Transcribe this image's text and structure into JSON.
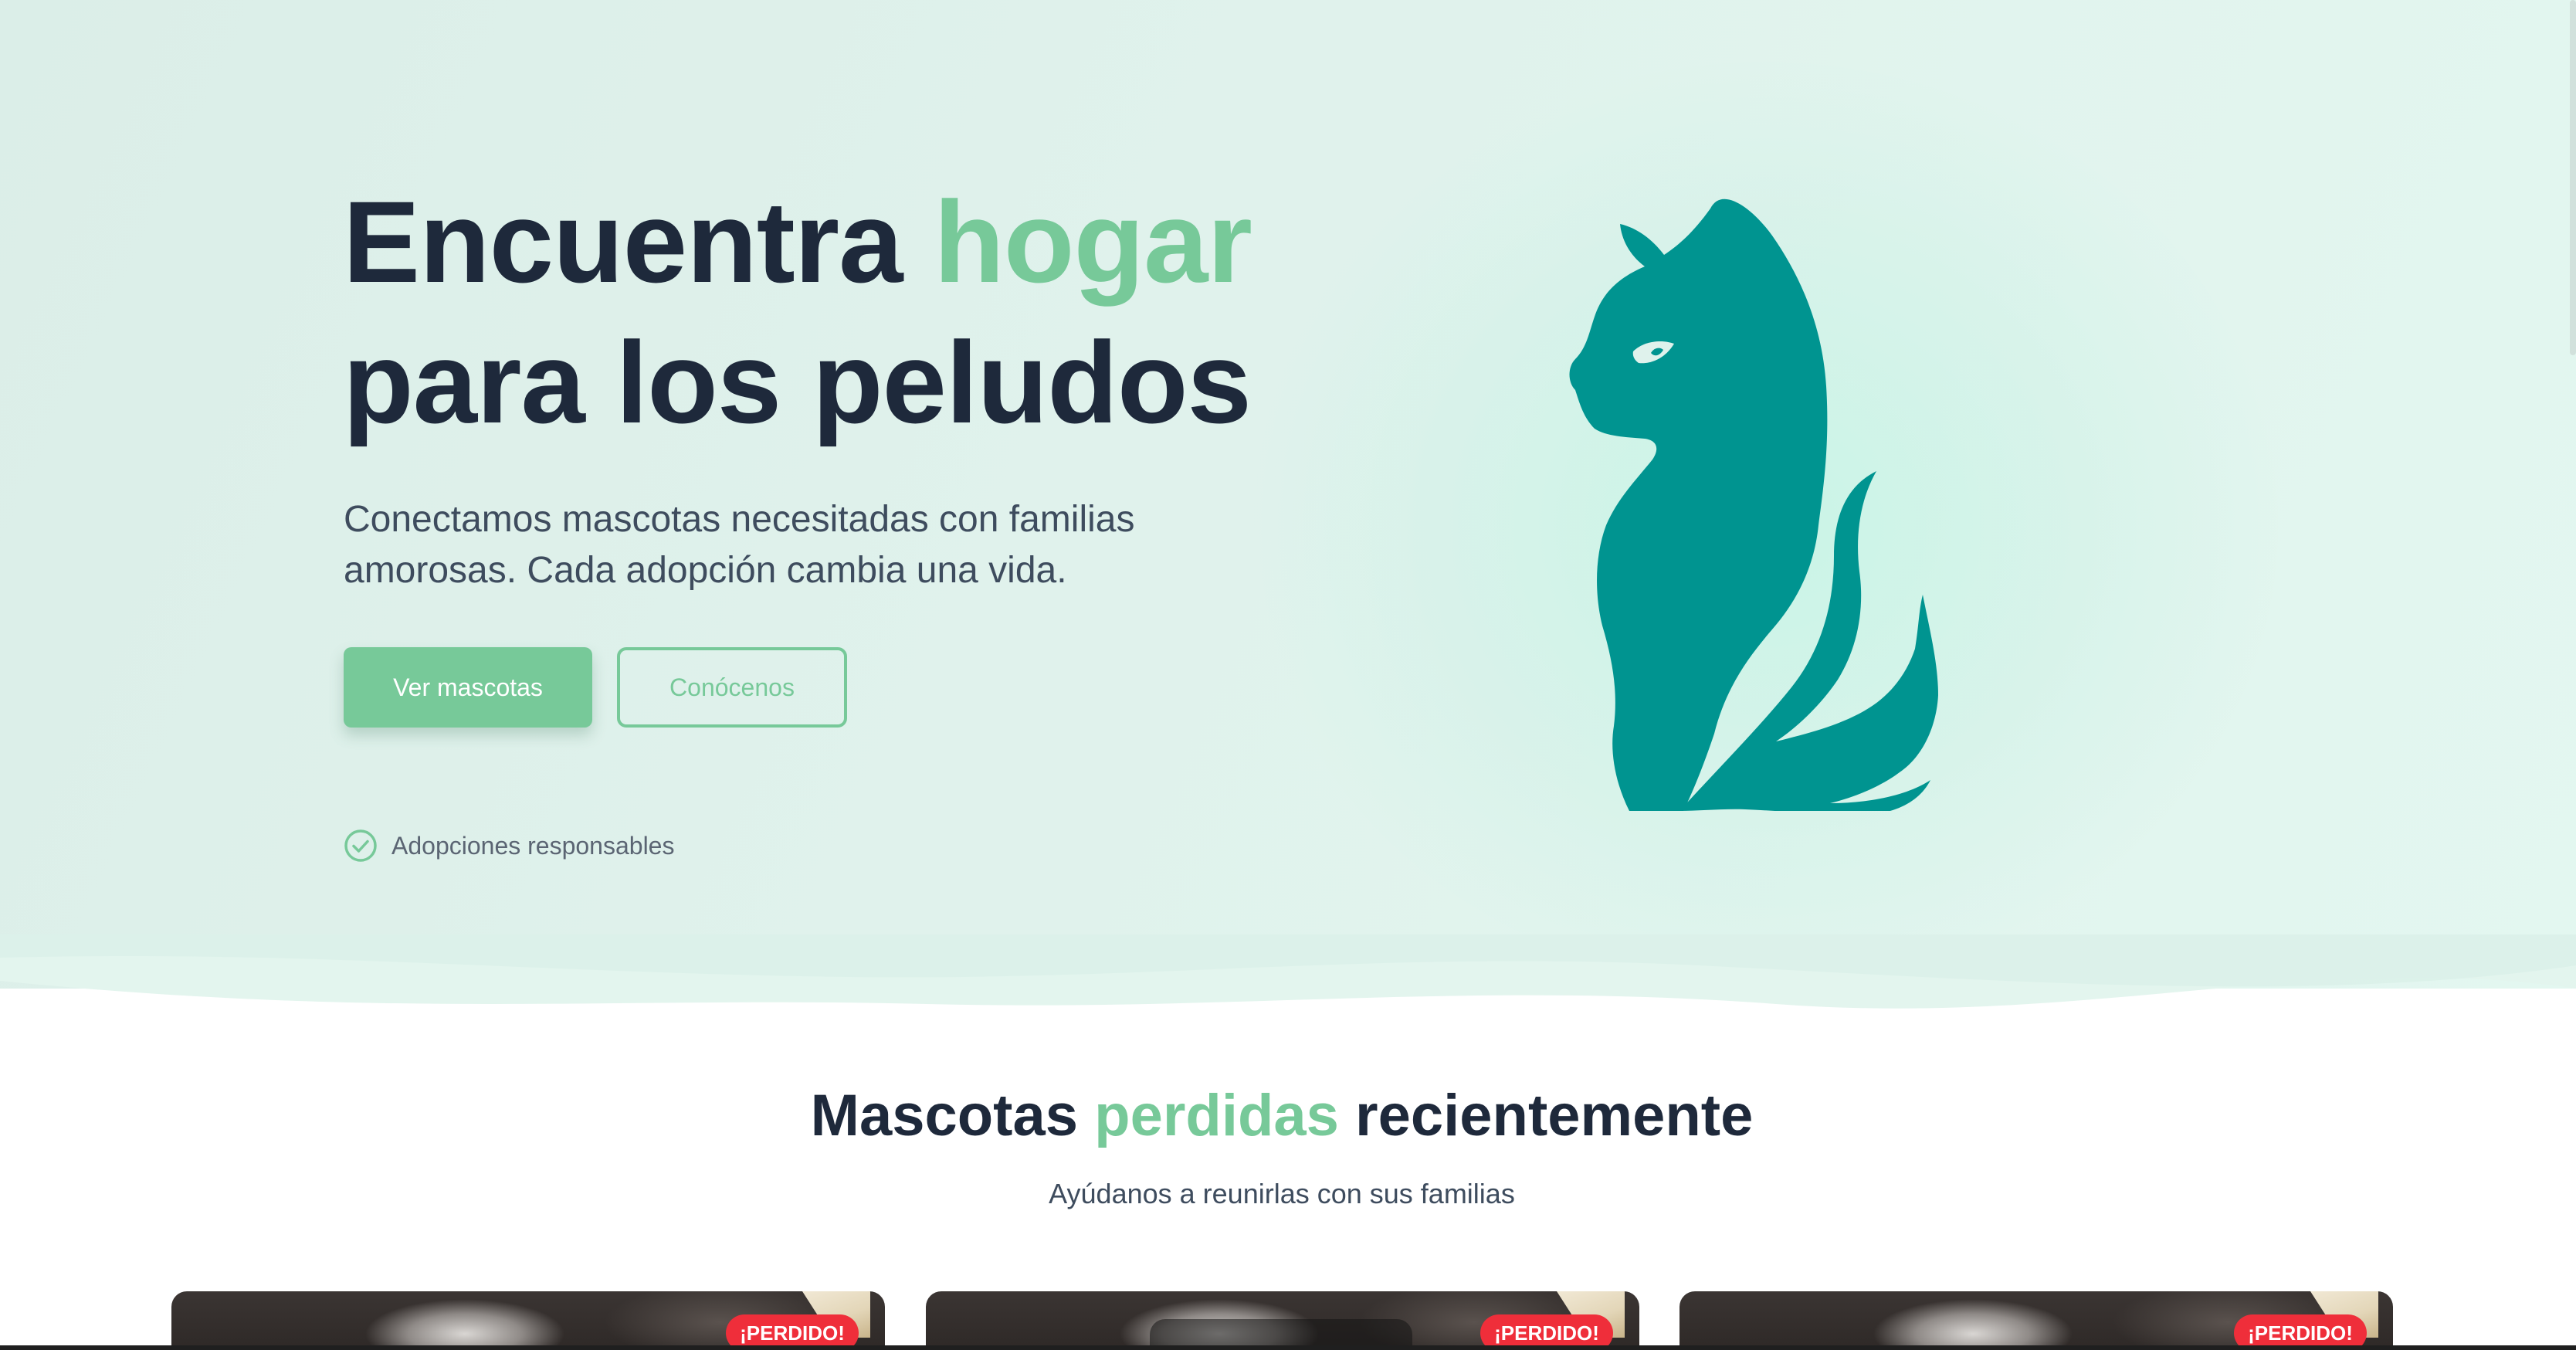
{
  "hero": {
    "title_part1": "Encuentra ",
    "title_accent": "hogar",
    "title_part2": "para los peludos",
    "subtitle": "Conectamos mascotas necesitadas con familias amorosas. Cada adopción cambia una vida.",
    "primary_button": "Ver mascotas",
    "secondary_button": "Conócenos",
    "feature": "Adopciones responsables"
  },
  "lost_section": {
    "title_part1": "Mascotas ",
    "title_accent": "perdidas",
    "title_part2": " recientemente",
    "subtitle": "Ayúdanos a reunirlas con sus familias",
    "cards": [
      {
        "badge": "¡PERDIDO!"
      },
      {
        "badge": "¡PERDIDO!"
      },
      {
        "badge": "¡PERDIDO!"
      }
    ]
  },
  "colors": {
    "accent": "#77c999",
    "cat": "#009490",
    "heading": "#1e293b",
    "badge": "#ef2e3a"
  },
  "icons": {
    "feature": "check-circle-icon",
    "hero_illustration": "cat-silhouette-icon"
  }
}
